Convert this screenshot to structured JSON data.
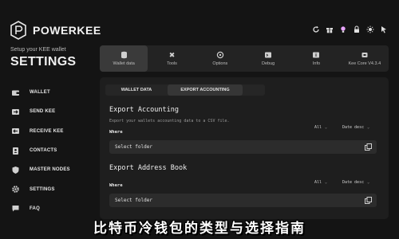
{
  "brand": {
    "name": "POWERKEE",
    "subtitle": "Setup your KEE wallet",
    "title": "SETTINGS"
  },
  "sidebar": {
    "items": [
      {
        "label": "WALLET",
        "icon": "wallet-icon"
      },
      {
        "label": "SEND KEE",
        "icon": "send-icon"
      },
      {
        "label": "RECEIVE KEE",
        "icon": "receive-icon"
      },
      {
        "label": "CONTACTS",
        "icon": "contacts-icon"
      },
      {
        "label": "MASTER NODES",
        "icon": "shield-icon"
      },
      {
        "label": "SETTINGS",
        "icon": "gear-icon"
      },
      {
        "label": "FAQ",
        "icon": "chat-icon"
      }
    ]
  },
  "topbar": {
    "icons": [
      "refresh-icon",
      "gift-icon",
      "bulb-icon",
      "lock-icon",
      "sun-icon",
      "cursor-icon"
    ]
  },
  "tabs": [
    {
      "label": "Wallet data",
      "icon": "database-icon",
      "active": true
    },
    {
      "label": "Tools",
      "icon": "tools-icon"
    },
    {
      "label": "Options",
      "icon": "options-icon"
    },
    {
      "label": "Debug",
      "icon": "debug-icon"
    },
    {
      "label": "Info",
      "icon": "info-icon"
    },
    {
      "label": "Kee Core V4.3.4",
      "icon": "core-icon"
    }
  ],
  "subtabs": {
    "wallet_data": "WALLET DATA",
    "export_accounting": "EXPORT ACCOUNTING"
  },
  "export_accounting": {
    "title": "Export Accounting",
    "description": "Export your wallets accounting data to a CSV file.",
    "filter": "All",
    "sort": "Date desc",
    "where_label": "Where",
    "folder_placeholder": "Select folder"
  },
  "export_address_book": {
    "title": "Export Address Book",
    "where_label": "Where",
    "filter": "All",
    "sort": "Date desc",
    "folder_placeholder": "Select folder"
  },
  "caption": "比特币冷钱包的类型与选择指南"
}
